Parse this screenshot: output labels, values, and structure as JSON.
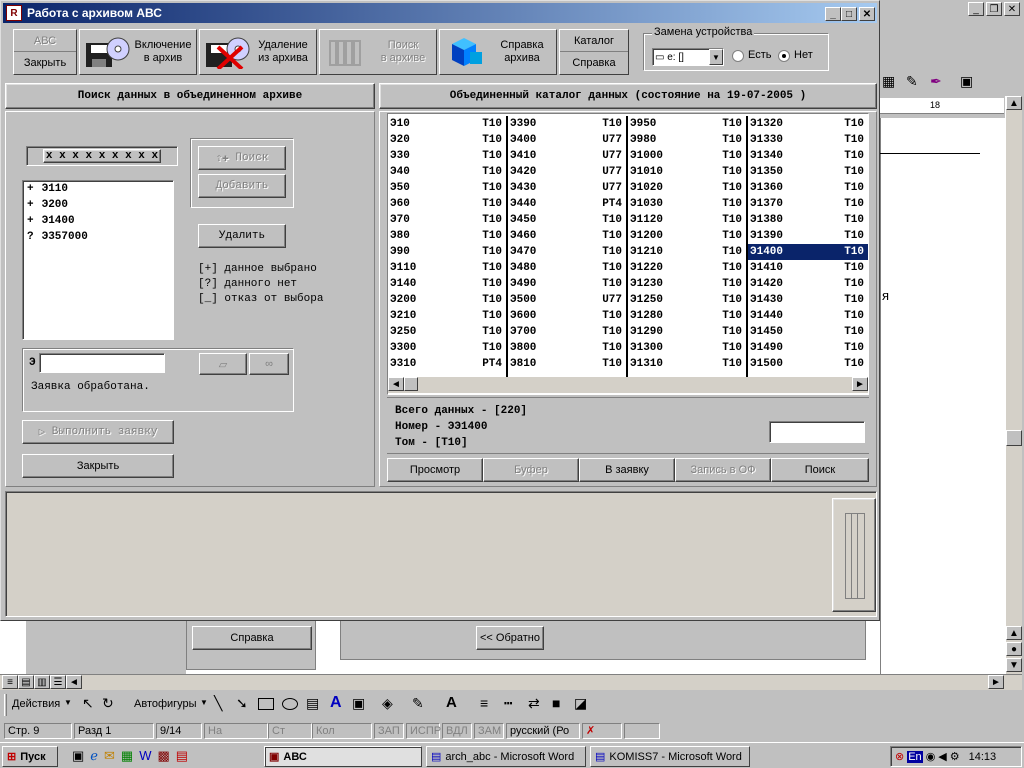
{
  "window": {
    "title": "Работа с архивом АВС",
    "controls": [
      "_",
      "□",
      "✕"
    ]
  },
  "toolbar": {
    "abc_label": "АВС",
    "close_label": "Закрыть",
    "include_label_1": "Включение",
    "include_label_2": "в архив",
    "remove_label_1": "Удаление",
    "remove_label_2": "из архива",
    "search_label_1": "Поиск",
    "search_label_2": "в архиве",
    "help_label_1": "Справка",
    "help_label_2": "архива",
    "catalog_label": "Каталог",
    "reference_label": "Справка",
    "device_group_label": "Замена устройства",
    "drive_value": "e: []",
    "radio_yes": "Есть",
    "radio_no": "Нет"
  },
  "left_panel": {
    "title": "Поиск данных в объединенном архиве",
    "mask": "x x x x x x x x x",
    "search_button": "Поиск",
    "add_button": "Добавить",
    "delete_button": "Удалить",
    "list_items": [
      {
        "mark": "+",
        "code": "Э110"
      },
      {
        "mark": "+",
        "code": "Э200"
      },
      {
        "mark": "+",
        "code": "Э1400"
      },
      {
        "mark": "?",
        "code": "Э357000"
      }
    ],
    "legend": [
      "[+] данное выбрано",
      "[?] данного нет",
      "[_] отказ от выбора"
    ],
    "request_prefix": "Э",
    "request_value": "",
    "request_status": "Заявка  обработана.",
    "execute_button": "Выполнить заявку",
    "close_button": "Закрыть"
  },
  "right_panel": {
    "title": "Объединенный каталог данных (состояние на 19-07-2005 )",
    "columns": [
      [
        [
          "Э10",
          "T10"
        ],
        [
          "Э20",
          "T10"
        ],
        [
          "Э30",
          "T10"
        ],
        [
          "Э40",
          "T10"
        ],
        [
          "Э50",
          "T10"
        ],
        [
          "Э60",
          "T10"
        ],
        [
          "Э70",
          "T10"
        ],
        [
          "Э80",
          "T10"
        ],
        [
          "Э90",
          "T10"
        ],
        [
          "Э110",
          "T10"
        ],
        [
          "Э140",
          "T10"
        ],
        [
          "Э200",
          "T10"
        ],
        [
          "Э210",
          "T10"
        ],
        [
          "Э250",
          "T10"
        ],
        [
          "Э300",
          "T10"
        ],
        [
          "Э310",
          "PT4"
        ]
      ],
      [
        [
          "Э390",
          "T10"
        ],
        [
          "Э400",
          "U77"
        ],
        [
          "Э410",
          "U77"
        ],
        [
          "Э420",
          "U77"
        ],
        [
          "Э430",
          "U77"
        ],
        [
          "Э440",
          "PT4"
        ],
        [
          "Э450",
          "T10"
        ],
        [
          "Э460",
          "T10"
        ],
        [
          "Э470",
          "T10"
        ],
        [
          "Э480",
          "T10"
        ],
        [
          "Э490",
          "T10"
        ],
        [
          "Э500",
          "U77"
        ],
        [
          "Э600",
          "T10"
        ],
        [
          "Э700",
          "T10"
        ],
        [
          "Э800",
          "T10"
        ],
        [
          "Э810",
          "T10"
        ]
      ],
      [
        [
          "Э950",
          "T10"
        ],
        [
          "Э980",
          "T10"
        ],
        [
          "Э1000",
          "T10"
        ],
        [
          "Э1010",
          "T10"
        ],
        [
          "Э1020",
          "T10"
        ],
        [
          "Э1030",
          "T10"
        ],
        [
          "Э1120",
          "T10"
        ],
        [
          "Э1200",
          "T10"
        ],
        [
          "Э1210",
          "T10"
        ],
        [
          "Э1220",
          "T10"
        ],
        [
          "Э1230",
          "T10"
        ],
        [
          "Э1250",
          "T10"
        ],
        [
          "Э1280",
          "T10"
        ],
        [
          "Э1290",
          "T10"
        ],
        [
          "Э1300",
          "T10"
        ],
        [
          "Э1310",
          "T10"
        ]
      ],
      [
        [
          "Э1320",
          "T10"
        ],
        [
          "Э1330",
          "T10"
        ],
        [
          "Э1340",
          "T10"
        ],
        [
          "Э1350",
          "T10"
        ],
        [
          "Э1360",
          "T10"
        ],
        [
          "Э1370",
          "T10"
        ],
        [
          "Э1380",
          "T10"
        ],
        [
          "Э1390",
          "T10"
        ],
        [
          "Э1400",
          "T10"
        ],
        [
          "Э1410",
          "T10"
        ],
        [
          "Э1420",
          "T10"
        ],
        [
          "Э1430",
          "T10"
        ],
        [
          "Э1440",
          "T10"
        ],
        [
          "Э1450",
          "T10"
        ],
        [
          "Э1490",
          "T10"
        ],
        [
          "Э1500",
          "T10"
        ]
      ]
    ],
    "selected": {
      "column": 3,
      "row": 8
    },
    "info_total": "Всего данных - [220]",
    "info_number": "Номер - ЭЭ1400",
    "info_volume": "Том - [T10]",
    "buttons": {
      "view": "Просмотр",
      "buffer": "Буфер",
      "to_request": "В заявку",
      "write_of": "Запись в ОФ",
      "search": "Поиск"
    }
  },
  "background": {
    "help_button": "Справка",
    "back_button": "<< Обратно",
    "ruler_mark": "18",
    "doc_letter": "я"
  },
  "drawing_toolbar": {
    "actions": "Действия",
    "autoshapes": "Автофигуры"
  },
  "status_bar": {
    "page": "Стр.  9",
    "section": "Разд  1",
    "pages": "9/14",
    "at": "На",
    "line": "Ст",
    "col": "Кол",
    "rec": "ЗАП",
    "trk": "ИСПР",
    "ext": "ВДЛ",
    "ovr": "ЗАМ",
    "lang": "русский (Ро"
  },
  "taskbar": {
    "start": "Пуск",
    "tasks": [
      "АВС",
      "arch_abc - Microsoft Word",
      "KOMISS7 - Microsoft Word"
    ],
    "lang": "En",
    "clock": "14:13"
  }
}
